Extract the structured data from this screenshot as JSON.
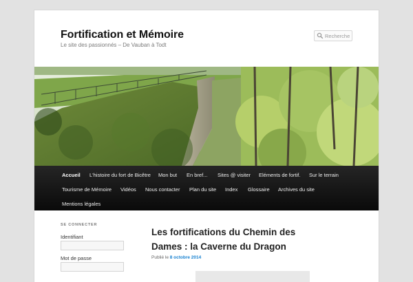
{
  "site": {
    "title": "Fortification et Mémoire",
    "description": "Le site des passionnés – De Vauban à Todt"
  },
  "search": {
    "placeholder": "Recherche"
  },
  "header_image": {
    "alt": ""
  },
  "nav": {
    "items": [
      {
        "label": "Accueil",
        "current": true
      },
      {
        "label": "L'histoire du fort de Bicêtre"
      },
      {
        "label": "Mon but"
      },
      {
        "label": "En bref..."
      },
      {
        "label": "Sites @ visiter"
      },
      {
        "label": "Eléments de fortif."
      },
      {
        "label": "Sur le terrain"
      },
      {
        "label": "Tourisme de Mémoire"
      },
      {
        "label": "Vidéos"
      },
      {
        "label": "Nous contacter"
      },
      {
        "label": "Plan du site"
      },
      {
        "label": "Index"
      },
      {
        "label": "Glossaire"
      },
      {
        "label": "Archives du site"
      },
      {
        "label": "Mentions légales"
      }
    ]
  },
  "sidebar": {
    "login": {
      "heading": "SE CONNECTER",
      "username_label": "Identifiant",
      "password_label": "Mot de passe"
    }
  },
  "post": {
    "title": "Les fortifications du Chemin des Dames : la Caverne du Dragon",
    "meta_prefix": "Publié le",
    "date": "8 octobre 2014"
  },
  "colors": {
    "link_blue": "#1982d1",
    "nav_bg": "#111111",
    "page_bg": "#e2e2e2"
  }
}
